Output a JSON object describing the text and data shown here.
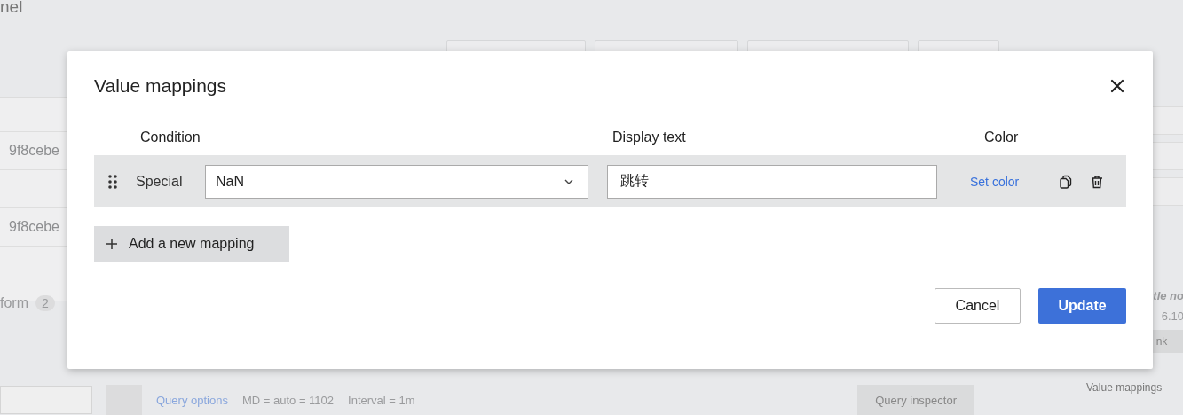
{
  "background": {
    "header_text": "nel",
    "table_rows": [
      {
        "cell": "9f8cebe"
      },
      {
        "cell": ""
      },
      {
        "cell": "9f8cebe"
      }
    ],
    "tab_label": "form",
    "tab_count": "2",
    "query_row": {
      "options_link": "Query options",
      "md_text": "MD = auto = 1102",
      "interval_text": "Interval = 1m",
      "inspector_button": "Query inspector"
    },
    "sidebar": {
      "italic_text": "tle no",
      "version_text": "6.10",
      "button": "nk",
      "section": "Value mappings"
    }
  },
  "dialog": {
    "title": "Value mappings",
    "columns": [
      "Condition",
      "Display text",
      "Color"
    ],
    "mappings": [
      {
        "type": "Special",
        "value": "NaN",
        "display_text": "跳转",
        "color_link": "Set color"
      }
    ],
    "add_button": "Add a new mapping",
    "buttons": [
      {
        "label": "Cancel",
        "kind": "secondary"
      },
      {
        "label": "Update",
        "kind": "primary"
      }
    ]
  }
}
